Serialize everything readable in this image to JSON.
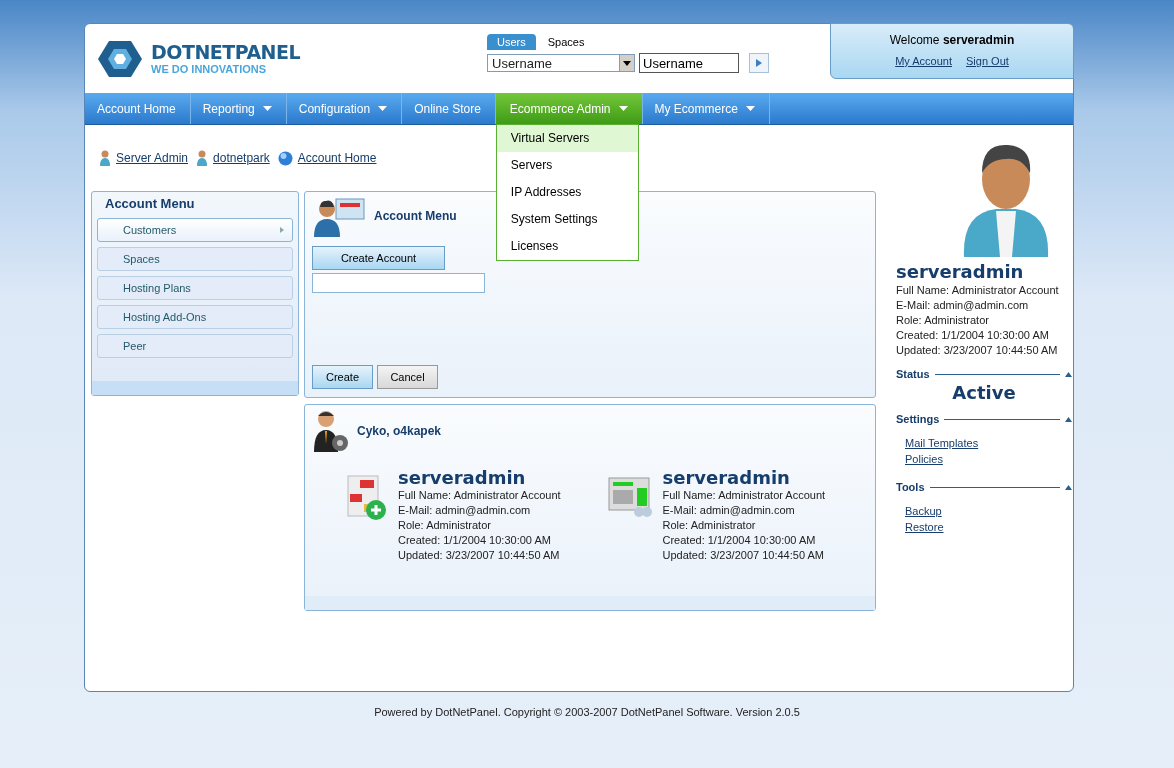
{
  "header": {
    "logo_title": "DOTNETPANEL",
    "logo_tagline": "WE DO INNOVATIONS",
    "search_tabs": [
      {
        "label": "Users",
        "selected": true
      },
      {
        "label": "Spaces",
        "selected": false
      }
    ],
    "search_select": "Username",
    "search_input": "Username",
    "welcome_prefix": "Welcome",
    "welcome_user": "serveradmin",
    "links": [
      "My Account",
      "Sign Out"
    ]
  },
  "nav": {
    "items": [
      {
        "label": "Account Home",
        "has_menu": false,
        "selected": false
      },
      {
        "label": "Reporting",
        "has_menu": true,
        "selected": false
      },
      {
        "label": "Configuration",
        "has_menu": true,
        "selected": false
      },
      {
        "label": "Online Store",
        "has_menu": false,
        "selected": false
      },
      {
        "label": "Ecommerce Admin",
        "has_menu": true,
        "selected": true
      },
      {
        "label": "My Ecommerce",
        "has_menu": true,
        "selected": false
      }
    ],
    "dropdown": [
      {
        "label": "Virtual Servers",
        "selected": true
      },
      {
        "label": "Servers",
        "selected": false
      },
      {
        "label": "IP Addresses",
        "selected": false
      },
      {
        "label": "System Settings",
        "selected": false
      },
      {
        "label": "Licenses",
        "selected": false
      }
    ]
  },
  "breadcrumb": [
    {
      "label": "Server Admin",
      "kind": "user"
    },
    {
      "label": "dotnetpark",
      "kind": "user"
    },
    {
      "label": "Account Home",
      "kind": "globe"
    }
  ],
  "account_menu": {
    "title": "Account Menu",
    "items": [
      {
        "label": "Customers",
        "selected": true
      },
      {
        "label": "Spaces",
        "selected": false
      },
      {
        "label": "Hosting Plans",
        "selected": false
      },
      {
        "label": "Hosting Add-Ons",
        "selected": false
      },
      {
        "label": "Peer",
        "selected": false
      }
    ]
  },
  "account_panel": {
    "title": "Account Menu",
    "create_account": "Create Account",
    "buttons": [
      {
        "label": "Create",
        "kind": "primary"
      },
      {
        "label": "Cancel",
        "kind": "secondary"
      }
    ]
  },
  "users_panel": {
    "title": "Cyko, o4kapek",
    "cards": [
      {
        "name": "serveradmin",
        "details": [
          "Full Name: Administrator Account",
          "E-Mail: admin@admin.com",
          "Role: Administrator",
          "Created: 1/1/2004 10:30:00 AM",
          "Updated: 3/23/2007 10:44:50 AM"
        ]
      },
      {
        "name": "serveradmin",
        "details": [
          "Full Name: Administrator Account",
          "E-Mail: admin@admin.com",
          "Role: Administrator",
          "Created: 1/1/2004 10:30:00 AM",
          "Updated: 3/23/2007 10:44:50 AM"
        ]
      }
    ]
  },
  "profile": {
    "name": "serveradmin",
    "details": [
      "Full Name: Administrator Account",
      "E-Mail: admin@admin.com",
      "Role: Administrator",
      "Created: 1/1/2004 10:30:00 AM",
      "Updated: 3/23/2007 10:44:50 AM"
    ],
    "status_title": "Status",
    "status": "Active",
    "sections": [
      {
        "title": "Settings",
        "links": [
          "Mail Templates",
          "Policies"
        ]
      },
      {
        "title": "Tools",
        "links": [
          "Backup",
          "Restore"
        ]
      }
    ]
  },
  "footer": "Powered by DotNetPanel. Copyright © 2003-2007 DotNetPanel Software.  Version 2.0.5"
}
